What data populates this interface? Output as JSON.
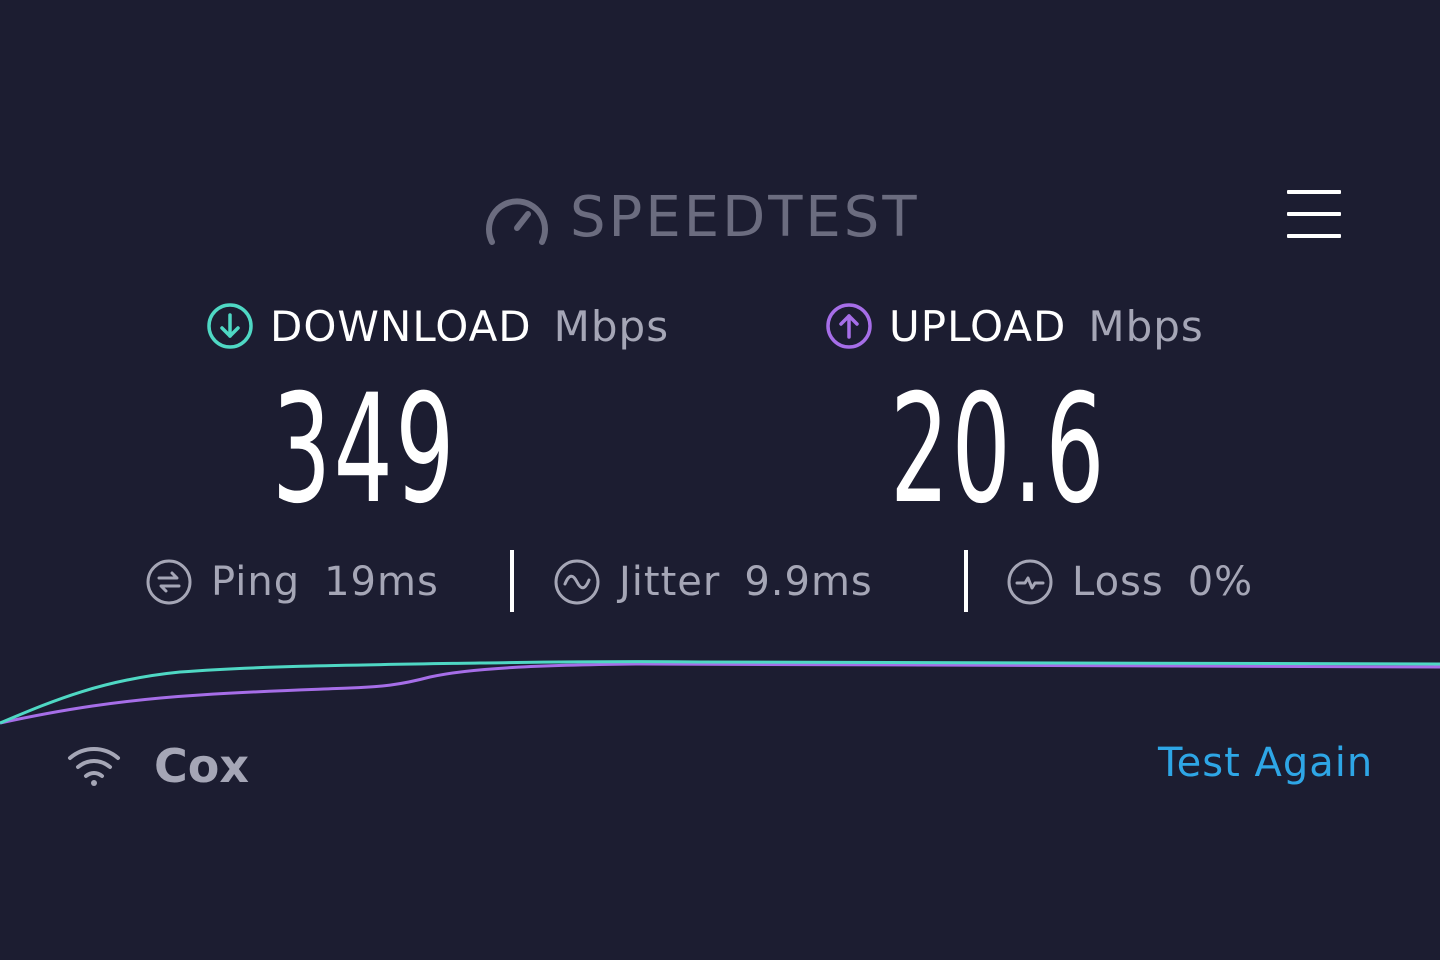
{
  "header": {
    "logo_text": "SPEEDTEST",
    "logo_icon": "speedometer-icon",
    "menu_icon": "hamburger-menu-icon"
  },
  "download": {
    "label": "DOWNLOAD",
    "unit": "Mbps",
    "value": "349",
    "icon": "download-arrow-icon",
    "color": "#4fd8c4"
  },
  "upload": {
    "label": "UPLOAD",
    "unit": "Mbps",
    "value": "20.6",
    "icon": "upload-arrow-icon",
    "color": "#a66ee8"
  },
  "stats": {
    "ping": {
      "label": "Ping",
      "value": "19ms",
      "icon": "ping-icon"
    },
    "jitter": {
      "label": "Jitter",
      "value": "9.9ms",
      "icon": "jitter-icon"
    },
    "loss": {
      "label": "Loss",
      "value": "0%",
      "icon": "loss-icon"
    }
  },
  "footer": {
    "isp_name": "Cox",
    "isp_icon": "wifi-icon",
    "test_again_label": "Test Again",
    "test_again_color": "#2ea6e6"
  }
}
